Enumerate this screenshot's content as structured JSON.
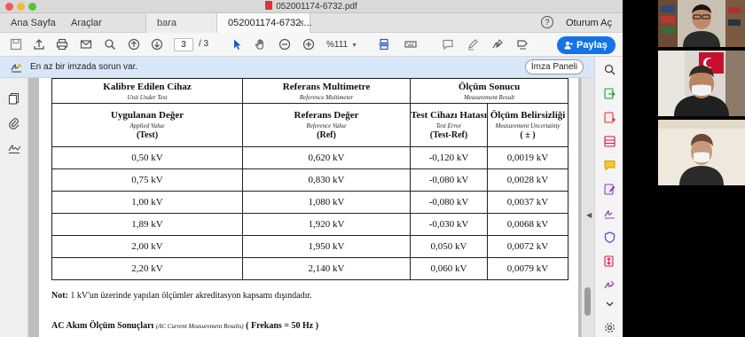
{
  "window": {
    "title": "052001174-6732.pdf"
  },
  "tabs": {
    "home": "Ana Sayfa",
    "tools": "Araçlar",
    "doc1": "bara",
    "doc2": "052001174-6732....",
    "close": "×",
    "help": "?",
    "signin": "Oturum Aç"
  },
  "toolbar": {
    "page_current": "3",
    "page_total": "/ 3",
    "zoom": "%111",
    "share_label": "Paylaş"
  },
  "message": {
    "text": "En az bir imzada sorun var.",
    "signature_panel": "İmza Paneli"
  },
  "table": {
    "header1": {
      "col1": {
        "tr": "Kalibre Edilen Cihaz",
        "en": "Unit Under Test"
      },
      "col2": {
        "tr": "Referans Multimetre",
        "en": "Reference Multimeter"
      },
      "col3": {
        "tr": "Ölçüm Sonucu",
        "en": "Measurement Result"
      }
    },
    "header2": {
      "col1": {
        "tr": "Uygulanan Değer",
        "en": "Applied Value",
        "sub": "(Test)"
      },
      "col2": {
        "tr": "Referans Değer",
        "en": "Reference Value",
        "sub": "(Ref)"
      },
      "col3": {
        "tr": "Test Cihazı Hatası",
        "en": "Test Error",
        "sub": "(Test-Ref)"
      },
      "col4": {
        "tr": "Ölçüm Belirsizliği",
        "en": "Measurement Uncertainty",
        "sub": "( ± )"
      }
    },
    "rows": [
      [
        "0,50 kV",
        "0,620 kV",
        "-0,120 kV",
        "0,0019 kV"
      ],
      [
        "0,75 kV",
        "0,830 kV",
        "-0,080 kV",
        "0,0028 kV"
      ],
      [
        "1,00 kV",
        "1,080 kV",
        "-0,080 kV",
        "0,0037 kV"
      ],
      [
        "1,89 kV",
        "1,920 kV",
        "-0,030 kV",
        "0,0068 kV"
      ],
      [
        "2,00 kV",
        "1,950 kV",
        "0,050 kV",
        "0,0072 kV"
      ],
      [
        "2,20 kV",
        "2,140 kV",
        "0,060 kV",
        "0,0079 kV"
      ]
    ]
  },
  "note": {
    "label": "Not:",
    "text": "1 kV'un üzerinde yapılan ölçümler akreditasyon kapsamı dışındadır."
  },
  "ac_section": {
    "title": "AC Akım Ölçüm Sonuçları",
    "subtitle": "(AC Current Measurement Results)",
    "freq": "( Frekans = 50 Hz )"
  },
  "colors": {
    "accent": "#1473e6",
    "message_bar": "#d7e7f8"
  }
}
